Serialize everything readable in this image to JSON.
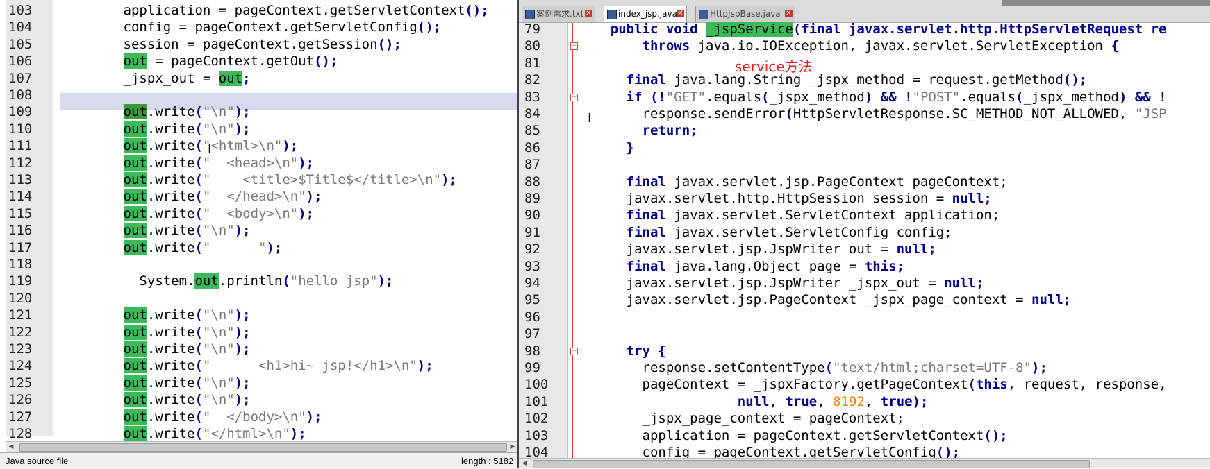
{
  "left_editor": {
    "lines": [
      {
        "n": "103",
        "segs": [
          {
            "t": "        application = pageContext.getServletContext",
            "c": "p"
          },
          {
            "t": "();",
            "c": "op"
          }
        ]
      },
      {
        "n": "104",
        "segs": [
          {
            "t": "        config = pageContext.getServletConfig",
            "c": "p"
          },
          {
            "t": "();",
            "c": "op"
          }
        ]
      },
      {
        "n": "105",
        "segs": [
          {
            "t": "        session = pageContext.getSession",
            "c": "p"
          },
          {
            "t": "();",
            "c": "op"
          }
        ]
      },
      {
        "n": "106",
        "segs": [
          {
            "t": "        ",
            "c": "p"
          },
          {
            "t": "out",
            "c": "hl"
          },
          {
            "t": " = pageContext.getOut",
            "c": "p"
          },
          {
            "t": "();",
            "c": "op"
          }
        ]
      },
      {
        "n": "107",
        "segs": [
          {
            "t": "        _jspx_out = ",
            "c": "p"
          },
          {
            "t": "out",
            "c": "hl"
          },
          {
            "t": ";",
            "c": "op"
          }
        ]
      },
      {
        "n": "108",
        "segs": []
      },
      {
        "n": "109",
        "segs": [
          {
            "t": "        ",
            "c": "p"
          },
          {
            "t": "out",
            "c": "hld"
          },
          {
            "t": ".write",
            "c": "p"
          },
          {
            "t": "(",
            "c": "op"
          },
          {
            "t": "\"\\n\"",
            "c": "str"
          },
          {
            "t": ");",
            "c": "op"
          }
        ]
      },
      {
        "n": "110",
        "segs": [
          {
            "t": "        ",
            "c": "p"
          },
          {
            "t": "out",
            "c": "hl"
          },
          {
            "t": ".write",
            "c": "p"
          },
          {
            "t": "(",
            "c": "op"
          },
          {
            "t": "\"\\n\"",
            "c": "str"
          },
          {
            "t": ");",
            "c": "op"
          }
        ]
      },
      {
        "n": "111",
        "segs": [
          {
            "t": "        ",
            "c": "p"
          },
          {
            "t": "out",
            "c": "hl"
          },
          {
            "t": ".write",
            "c": "p"
          },
          {
            "t": "(",
            "c": "op"
          },
          {
            "t": "\"<html>\\n\"",
            "c": "str"
          },
          {
            "t": ");",
            "c": "op"
          }
        ]
      },
      {
        "n": "112",
        "segs": [
          {
            "t": "        ",
            "c": "p"
          },
          {
            "t": "out",
            "c": "hl"
          },
          {
            "t": ".write",
            "c": "p"
          },
          {
            "t": "(",
            "c": "op"
          },
          {
            "t": "\"  <head>\\n\"",
            "c": "str"
          },
          {
            "t": ");",
            "c": "op"
          }
        ]
      },
      {
        "n": "113",
        "segs": [
          {
            "t": "        ",
            "c": "p"
          },
          {
            "t": "out",
            "c": "hl"
          },
          {
            "t": ".write",
            "c": "p"
          },
          {
            "t": "(",
            "c": "op"
          },
          {
            "t": "\"    <title>$Title$</title>\\n\"",
            "c": "str"
          },
          {
            "t": ");",
            "c": "op"
          }
        ]
      },
      {
        "n": "114",
        "segs": [
          {
            "t": "        ",
            "c": "p"
          },
          {
            "t": "out",
            "c": "hl"
          },
          {
            "t": ".write",
            "c": "p"
          },
          {
            "t": "(",
            "c": "op"
          },
          {
            "t": "\"  </head>\\n\"",
            "c": "str"
          },
          {
            "t": ");",
            "c": "op"
          }
        ]
      },
      {
        "n": "115",
        "segs": [
          {
            "t": "        ",
            "c": "p"
          },
          {
            "t": "out",
            "c": "hl"
          },
          {
            "t": ".write",
            "c": "p"
          },
          {
            "t": "(",
            "c": "op"
          },
          {
            "t": "\"  <body>\\n\"",
            "c": "str"
          },
          {
            "t": ");",
            "c": "op"
          }
        ]
      },
      {
        "n": "116",
        "segs": [
          {
            "t": "        ",
            "c": "p"
          },
          {
            "t": "out",
            "c": "hl"
          },
          {
            "t": ".write",
            "c": "p"
          },
          {
            "t": "(",
            "c": "op"
          },
          {
            "t": "\"\\n\"",
            "c": "str"
          },
          {
            "t": ");",
            "c": "op"
          }
        ]
      },
      {
        "n": "117",
        "segs": [
          {
            "t": "        ",
            "c": "p"
          },
          {
            "t": "out",
            "c": "hl"
          },
          {
            "t": ".write",
            "c": "p"
          },
          {
            "t": "(",
            "c": "op"
          },
          {
            "t": "\"      \"",
            "c": "str"
          },
          {
            "t": ");",
            "c": "op"
          }
        ]
      },
      {
        "n": "118",
        "segs": []
      },
      {
        "n": "119",
        "segs": [
          {
            "t": "          System.",
            "c": "p"
          },
          {
            "t": "out",
            "c": "hl"
          },
          {
            "t": ".println",
            "c": "p"
          },
          {
            "t": "(",
            "c": "op"
          },
          {
            "t": "\"hello jsp\"",
            "c": "str"
          },
          {
            "t": ");",
            "c": "op"
          }
        ]
      },
      {
        "n": "120",
        "segs": []
      },
      {
        "n": "121",
        "segs": [
          {
            "t": "        ",
            "c": "p"
          },
          {
            "t": "out",
            "c": "hl"
          },
          {
            "t": ".write",
            "c": "p"
          },
          {
            "t": "(",
            "c": "op"
          },
          {
            "t": "\"\\n\"",
            "c": "str"
          },
          {
            "t": ");",
            "c": "op"
          }
        ]
      },
      {
        "n": "122",
        "segs": [
          {
            "t": "        ",
            "c": "p"
          },
          {
            "t": "out",
            "c": "hl"
          },
          {
            "t": ".write",
            "c": "p"
          },
          {
            "t": "(",
            "c": "op"
          },
          {
            "t": "\"\\n\"",
            "c": "str"
          },
          {
            "t": ");",
            "c": "op"
          }
        ]
      },
      {
        "n": "123",
        "segs": [
          {
            "t": "        ",
            "c": "p"
          },
          {
            "t": "out",
            "c": "hl"
          },
          {
            "t": ".write",
            "c": "p"
          },
          {
            "t": "(",
            "c": "op"
          },
          {
            "t": "\"\\n\"",
            "c": "str"
          },
          {
            "t": ");",
            "c": "op"
          }
        ]
      },
      {
        "n": "124",
        "segs": [
          {
            "t": "        ",
            "c": "p"
          },
          {
            "t": "out",
            "c": "hl"
          },
          {
            "t": ".write",
            "c": "p"
          },
          {
            "t": "(",
            "c": "op"
          },
          {
            "t": "\"      <h1>hi~ jsp!</h1>\\n\"",
            "c": "str"
          },
          {
            "t": ");",
            "c": "op"
          }
        ]
      },
      {
        "n": "125",
        "segs": [
          {
            "t": "        ",
            "c": "p"
          },
          {
            "t": "out",
            "c": "hl"
          },
          {
            "t": ".write",
            "c": "p"
          },
          {
            "t": "(",
            "c": "op"
          },
          {
            "t": "\"\\n\"",
            "c": "str"
          },
          {
            "t": ");",
            "c": "op"
          }
        ]
      },
      {
        "n": "126",
        "segs": [
          {
            "t": "        ",
            "c": "p"
          },
          {
            "t": "out",
            "c": "hl"
          },
          {
            "t": ".write",
            "c": "p"
          },
          {
            "t": "(",
            "c": "op"
          },
          {
            "t": "\"\\n\"",
            "c": "str"
          },
          {
            "t": ");",
            "c": "op"
          }
        ]
      },
      {
        "n": "127",
        "segs": [
          {
            "t": "        ",
            "c": "p"
          },
          {
            "t": "out",
            "c": "hl"
          },
          {
            "t": ".write",
            "c": "p"
          },
          {
            "t": "(",
            "c": "op"
          },
          {
            "t": "\"  </body>\\n\"",
            "c": "str"
          },
          {
            "t": ");",
            "c": "op"
          }
        ]
      },
      {
        "n": "128",
        "segs": [
          {
            "t": "        ",
            "c": "p"
          },
          {
            "t": "out",
            "c": "hl"
          },
          {
            "t": ".write",
            "c": "p"
          },
          {
            "t": "(",
            "c": "op"
          },
          {
            "t": "\"</html>\\n\"",
            "c": "str"
          },
          {
            "t": ");",
            "c": "op"
          }
        ]
      }
    ]
  },
  "status_bar": {
    "file_type": "Java source file",
    "length": "length : 5182"
  },
  "right_editor": {
    "tabs": [
      {
        "label": "案例需求.txt",
        "active": false
      },
      {
        "label": "index_jsp.java",
        "active": true
      },
      {
        "label": "HttpJspBase.java",
        "active": false
      }
    ],
    "annotation": "service方法",
    "lines": [
      {
        "n": "79",
        "segs": [
          {
            "t": "    public void ",
            "c": "kwp"
          },
          {
            "t": "_jspService",
            "c": "hl"
          },
          {
            "t": "(",
            "c": "op"
          },
          {
            "t": "final ",
            "c": "kw"
          },
          {
            "t": "javax.servlet.http.HttpServletRequest re",
            "c": "kwp"
          }
        ]
      },
      {
        "n": "80",
        "segs": [
          {
            "t": "        ",
            "c": "p"
          },
          {
            "t": "throws ",
            "c": "kw"
          },
          {
            "t": "java.io.IOException, javax.servlet.ServletException ",
            "c": "p"
          },
          {
            "t": "{",
            "c": "op"
          }
        ]
      },
      {
        "n": "81",
        "segs": []
      },
      {
        "n": "82",
        "segs": [
          {
            "t": "      ",
            "c": "p"
          },
          {
            "t": "final ",
            "c": "kw"
          },
          {
            "t": "java.lang.String _jspx_method = request.getMethod",
            "c": "p"
          },
          {
            "t": "();",
            "c": "op"
          }
        ]
      },
      {
        "n": "83",
        "segs": [
          {
            "t": "      ",
            "c": "p"
          },
          {
            "t": "if ",
            "c": "kw"
          },
          {
            "t": "(!",
            "c": "op"
          },
          {
            "t": "\"GET\"",
            "c": "str"
          },
          {
            "t": ".equals",
            "c": "p"
          },
          {
            "t": "(",
            "c": "op"
          },
          {
            "t": "_jspx_method",
            "c": "p"
          },
          {
            "t": ") && !",
            "c": "op"
          },
          {
            "t": "\"POST\"",
            "c": "str"
          },
          {
            "t": ".equals",
            "c": "p"
          },
          {
            "t": "(",
            "c": "op"
          },
          {
            "t": "_jspx_method",
            "c": "p"
          },
          {
            "t": ") && !",
            "c": "op"
          }
        ]
      },
      {
        "n": "84",
        "segs": [
          {
            "t": "        response.sendError",
            "c": "p"
          },
          {
            "t": "(",
            "c": "op"
          },
          {
            "t": "HttpServletResponse.SC_METHOD_NOT_ALLOWED, ",
            "c": "p"
          },
          {
            "t": "\"JSP",
            "c": "str"
          }
        ]
      },
      {
        "n": "85",
        "segs": [
          {
            "t": "        ",
            "c": "p"
          },
          {
            "t": "return",
            "c": "kw"
          },
          {
            "t": ";",
            "c": "op"
          }
        ]
      },
      {
        "n": "86",
        "segs": [
          {
            "t": "      ",
            "c": "p"
          },
          {
            "t": "}",
            "c": "op"
          }
        ]
      },
      {
        "n": "87",
        "segs": []
      },
      {
        "n": "88",
        "segs": [
          {
            "t": "      ",
            "c": "p"
          },
          {
            "t": "final ",
            "c": "kw"
          },
          {
            "t": "javax.servlet.jsp.PageContext pageContext;",
            "c": "p"
          }
        ]
      },
      {
        "n": "89",
        "segs": [
          {
            "t": "      javax.servlet.http.HttpSession session = ",
            "c": "p"
          },
          {
            "t": "null",
            "c": "kw"
          },
          {
            "t": ";",
            "c": "op"
          }
        ]
      },
      {
        "n": "90",
        "segs": [
          {
            "t": "      ",
            "c": "p"
          },
          {
            "t": "final ",
            "c": "kw"
          },
          {
            "t": "javax.servlet.ServletContext application;",
            "c": "p"
          }
        ]
      },
      {
        "n": "91",
        "segs": [
          {
            "t": "      ",
            "c": "p"
          },
          {
            "t": "final ",
            "c": "kw"
          },
          {
            "t": "javax.servlet.ServletConfig config;",
            "c": "p"
          }
        ]
      },
      {
        "n": "92",
        "segs": [
          {
            "t": "      javax.servlet.jsp.JspWriter out = ",
            "c": "p"
          },
          {
            "t": "null",
            "c": "kw"
          },
          {
            "t": ";",
            "c": "op"
          }
        ]
      },
      {
        "n": "93",
        "segs": [
          {
            "t": "      ",
            "c": "p"
          },
          {
            "t": "final ",
            "c": "kw"
          },
          {
            "t": "java.lang.Object page = ",
            "c": "p"
          },
          {
            "t": "this",
            "c": "kw"
          },
          {
            "t": ";",
            "c": "op"
          }
        ]
      },
      {
        "n": "94",
        "segs": [
          {
            "t": "      javax.servlet.jsp.JspWriter _jspx_out = ",
            "c": "p"
          },
          {
            "t": "null",
            "c": "kw"
          },
          {
            "t": ";",
            "c": "op"
          }
        ]
      },
      {
        "n": "95",
        "segs": [
          {
            "t": "      javax.servlet.jsp.PageContext _jspx_page_context = ",
            "c": "p"
          },
          {
            "t": "null",
            "c": "kw"
          },
          {
            "t": ";",
            "c": "op"
          }
        ]
      },
      {
        "n": "96",
        "segs": []
      },
      {
        "n": "97",
        "segs": []
      },
      {
        "n": "98",
        "segs": [
          {
            "t": "      ",
            "c": "p"
          },
          {
            "t": "try ",
            "c": "kw"
          },
          {
            "t": "{",
            "c": "op"
          }
        ]
      },
      {
        "n": "99",
        "segs": [
          {
            "t": "        response.setContentType",
            "c": "p"
          },
          {
            "t": "(",
            "c": "op"
          },
          {
            "t": "\"text/html;charset=UTF-8\"",
            "c": "str"
          },
          {
            "t": ");",
            "c": "op"
          }
        ]
      },
      {
        "n": "100",
        "segs": [
          {
            "t": "        pageContext = _jspxFactory.getPageContext",
            "c": "p"
          },
          {
            "t": "(",
            "c": "op"
          },
          {
            "t": "this",
            "c": "kw"
          },
          {
            "t": ", request, response,",
            "c": "p"
          }
        ]
      },
      {
        "n": "101",
        "segs": [
          {
            "t": "                    ",
            "c": "p"
          },
          {
            "t": "null",
            "c": "kw"
          },
          {
            "t": ", ",
            "c": "p"
          },
          {
            "t": "true",
            "c": "kw"
          },
          {
            "t": ", ",
            "c": "p"
          },
          {
            "t": "8192",
            "c": "num"
          },
          {
            "t": ", ",
            "c": "p"
          },
          {
            "t": "true",
            "c": "kw"
          },
          {
            "t": ");",
            "c": "op"
          }
        ]
      },
      {
        "n": "102",
        "segs": [
          {
            "t": "        _jspx_page_context = pageContext;",
            "c": "p"
          }
        ]
      },
      {
        "n": "103",
        "segs": [
          {
            "t": "        application = pageContext.getServletContext",
            "c": "p"
          },
          {
            "t": "();",
            "c": "op"
          }
        ]
      },
      {
        "n": "104",
        "segs": [
          {
            "t": "        config = pageContext.getServletConfig",
            "c": "p"
          },
          {
            "t": "();",
            "c": "op"
          }
        ]
      }
    ]
  }
}
